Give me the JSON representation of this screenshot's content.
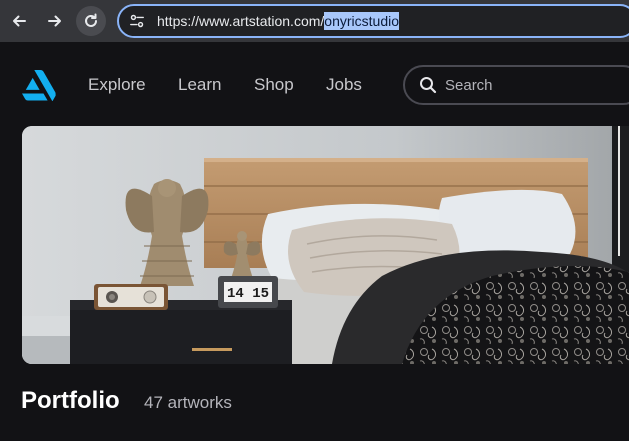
{
  "browser": {
    "url_prefix": "https://www.artstation.com/",
    "url_selected": "onyricstudio"
  },
  "site": {
    "nav": [
      "Explore",
      "Learn",
      "Shop",
      "Jobs"
    ],
    "search_placeholder": "Search"
  },
  "cover": {
    "clock_time": "14 15"
  },
  "portfolio": {
    "title": "Portfolio",
    "count": "47 artworks"
  },
  "colors": {
    "brand": "#13aff0",
    "background": "#121215",
    "address_focus": "#8ab4f8"
  },
  "icons": {
    "back": "arrow-left-icon",
    "forward": "arrow-right-icon",
    "reload": "reload-icon",
    "site_info": "tune-icon",
    "logo": "artstation-logo-icon",
    "search": "search-icon"
  }
}
